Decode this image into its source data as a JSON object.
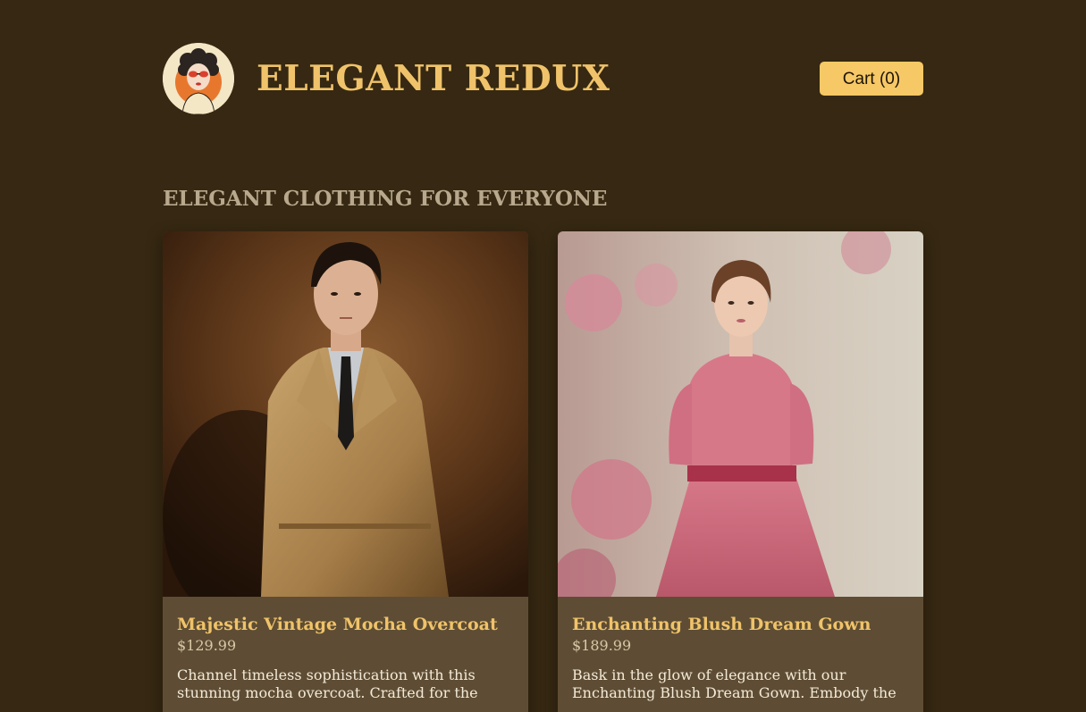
{
  "header": {
    "logo_icon": "woman-with-sunglasses-logo",
    "brand": "ELEGANT REDUX",
    "cart_label": "Cart (0)"
  },
  "section": {
    "title": "ELEGANT CLOTHING FOR EVERYONE"
  },
  "products": [
    {
      "image_icon": "man-in-trench-coat-photo",
      "name": "Majestic Vintage Mocha Overcoat",
      "price": "$129.99",
      "description": "Channel timeless sophistication with this stunning mocha overcoat. Crafted for the"
    },
    {
      "image_icon": "woman-in-pink-dress-photo",
      "name": "Enchanting Blush Dream Gown",
      "price": "$189.99",
      "description": "Bask in the glow of elegance with our Enchanting Blush Dream Gown. Embody the"
    }
  ],
  "colors": {
    "background": "#362812",
    "accent": "#f0c36a",
    "cart_button": "#f6c866",
    "card": "#5e4d34"
  }
}
